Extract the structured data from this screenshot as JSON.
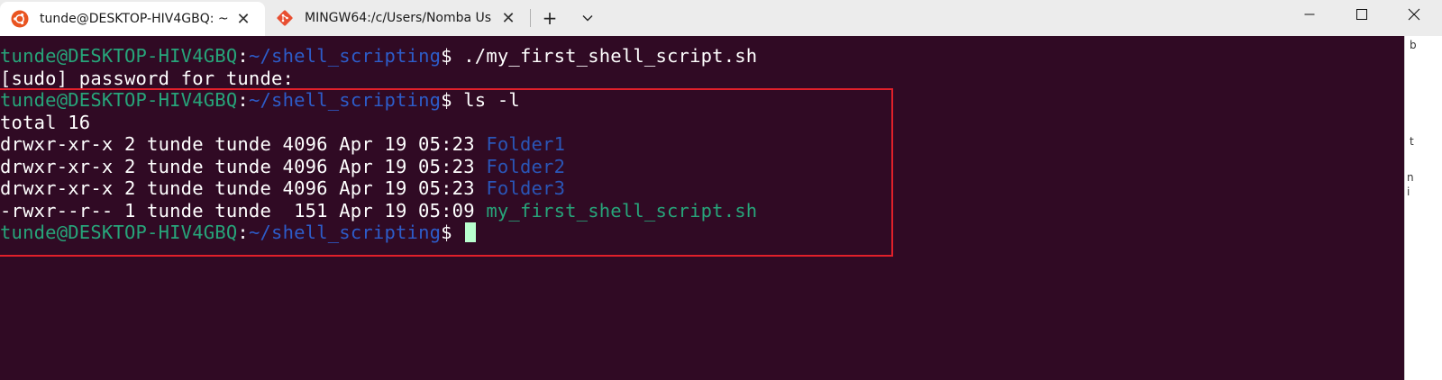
{
  "tabs": [
    {
      "title": "tunde@DESKTOP-HIV4GBQ: ~",
      "icon": "ubuntu-icon",
      "active": true
    },
    {
      "title": "MINGW64:/c/Users/Nomba Us",
      "icon": "git-icon",
      "active": false
    }
  ],
  "titlebar": {
    "new_tab": "+",
    "dropdown": "⌄",
    "close_tab": "✕"
  },
  "prompt": {
    "user_host": "tunde@DESKTOP-HIV4GBQ",
    "colon": ":",
    "path": "~/shell_scripting",
    "dollar": "$"
  },
  "terminal": {
    "line1_cmd": " ./my_first_shell_script.sh",
    "line2": "[sudo] password for tunde:",
    "line3_cmd": " ls -l",
    "line4": "total 16",
    "entries": [
      {
        "meta": "drwxr-xr-x 2 tunde tunde 4096 Apr 19 05:23 ",
        "name": "Folder1",
        "type": "dir"
      },
      {
        "meta": "drwxr-xr-x 2 tunde tunde 4096 Apr 19 05:23 ",
        "name": "Folder2",
        "type": "dir"
      },
      {
        "meta": "drwxr-xr-x 2 tunde tunde 4096 Apr 19 05:23 ",
        "name": "Folder3",
        "type": "dir"
      },
      {
        "meta": "-rwxr--r-- 1 tunde tunde  151 Apr 19 05:09 ",
        "name": "my_first_shell_script.sh",
        "type": "exe"
      }
    ]
  },
  "colors": {
    "terminal_bg": "#300a24",
    "prompt_user": "#27a57a",
    "prompt_path": "#2d5cc9",
    "highlight": "#e0202a",
    "cursor": "#b9ffcf"
  },
  "right_strip": {
    "chars": [
      "b",
      "t",
      "n",
      "i"
    ]
  }
}
